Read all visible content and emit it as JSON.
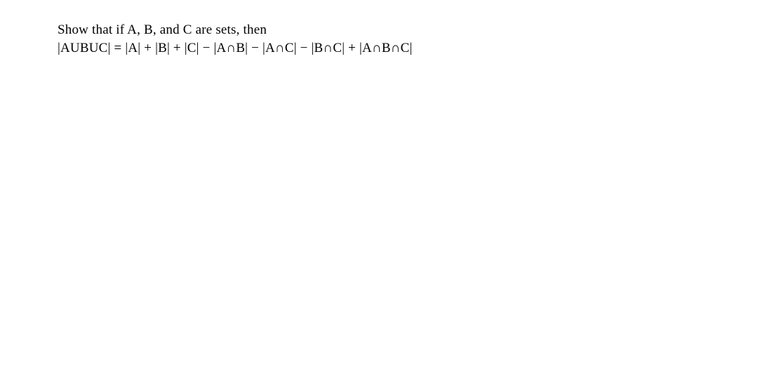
{
  "problem": {
    "line1": "Show that if A, B, and C are sets, then",
    "line2": "|AUBUC| = |A| + |B| + |C| − |A∩B| − |A∩C| − |B∩C| + |A∩B∩C|"
  }
}
